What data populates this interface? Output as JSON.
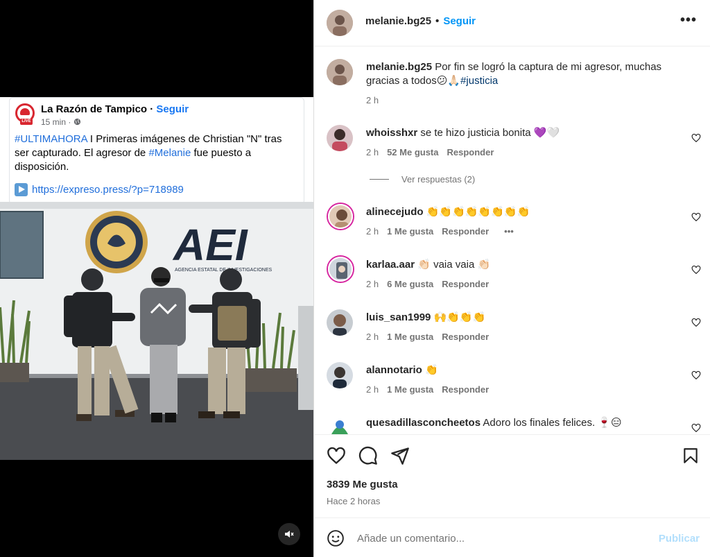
{
  "fb_post": {
    "page_name": "La Razón de Tampico",
    "sep": " · ",
    "follow": "Seguir",
    "time": "15 min ·",
    "live_badge": "LIVE",
    "text_tag1": "#ULTIMAHORA",
    "text_part1": " I  Primeras imágenes de Christian \"N\" tras ser capturado. El agresor de ",
    "text_tag2": "#Melanie",
    "text_part2": " fue puesto a disposición.",
    "link": "https://expreso.press/?p=718989",
    "photo_sign": "AEI",
    "photo_subsign": "AGENCIA ESTATAL DE INVESTIGACIONES"
  },
  "header": {
    "username": "melanie.bg25",
    "dot": "•",
    "follow": "Seguir",
    "more": "•••"
  },
  "caption": {
    "username": "melanie.bg25",
    "text": " Por fin se logró la captura de mi agresor, muchas gracias a todos😕🙏🏻",
    "tag": "#justicia",
    "time": "2 h"
  },
  "comments": [
    {
      "user": "whoisshxr",
      "text": "se te hizo justicia bonita 💜🤍",
      "time": "2 h",
      "likes": "52 Me gusta",
      "reply": "Responder"
    },
    {
      "user": "alinecejudo",
      "text": "👏👏👏👏👏👏👏👏",
      "time": "2 h",
      "likes": "1 Me gusta",
      "reply": "Responder",
      "more": "•••"
    },
    {
      "user": "karlaa.aar",
      "text": "👏🏻 vaia vaia 👏🏻",
      "time": "2 h",
      "likes": "6 Me gusta",
      "reply": "Responder"
    },
    {
      "user": "luis_san1999",
      "text": "🙌👏👏👏",
      "time": "2 h",
      "likes": "1 Me gusta",
      "reply": "Responder"
    },
    {
      "user": "alannotario",
      "text": "👏",
      "time": "2 h",
      "likes": "1 Me gusta",
      "reply": "Responder"
    },
    {
      "user": "quesadillasconcheetos",
      "text": "Adoro los finales felices. 🍷😑"
    }
  ],
  "view_replies": "Ver respuestas (2)",
  "likes_total": "3839 Me gusta",
  "posted": "Hace 2 horas",
  "add_comment": {
    "placeholder": "Añade un comentario...",
    "publish": "Publicar"
  },
  "colors": {
    "link_blue": "#0095f6",
    "tag_blue": "#00376b",
    "fb_blue": "#216fdb"
  }
}
